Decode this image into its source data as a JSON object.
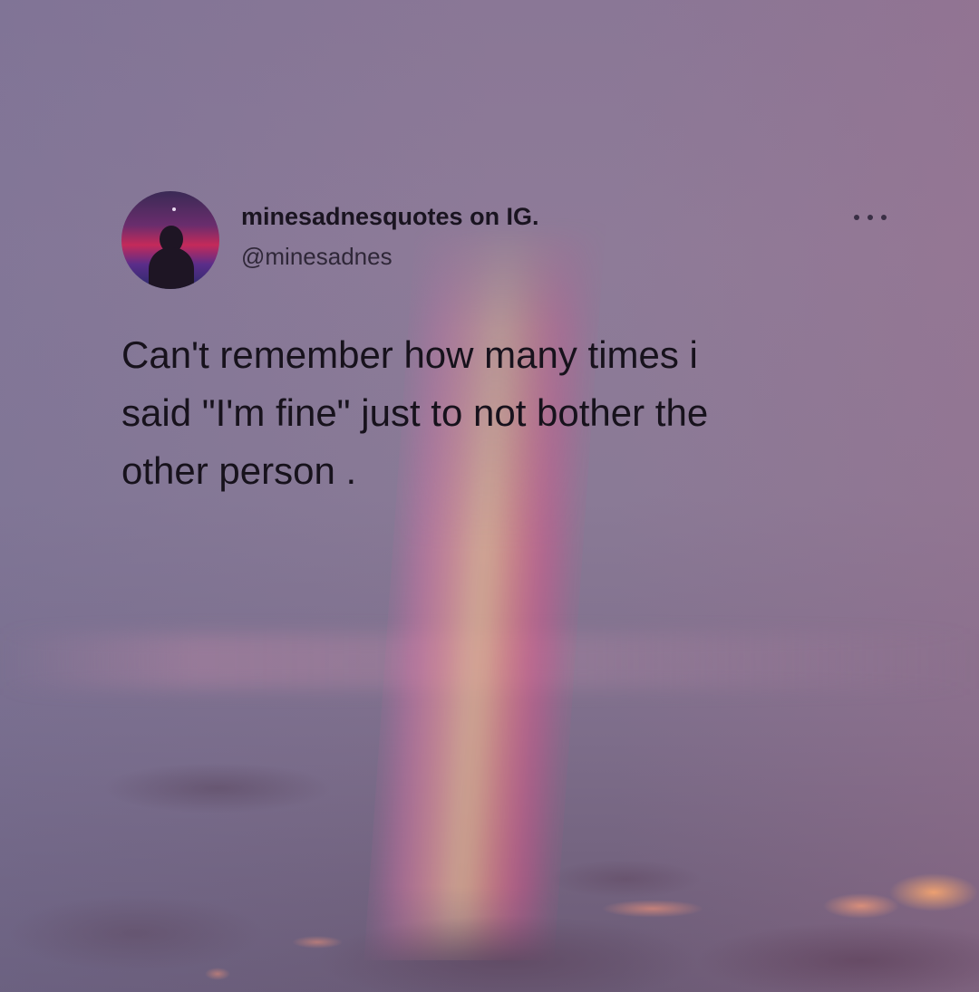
{
  "post": {
    "display_name": "minesadnesquotes on IG.",
    "handle": "@minesadnes",
    "text_lines": [
      "Can't remember how many times i",
      "said \"I'm fine\" just to not bother the",
      "other person ."
    ]
  },
  "icons": {
    "avatar": "avatar-image",
    "menu": "more-options-icon"
  },
  "colors": {
    "text": "#17121c",
    "background_top": "#8a7796",
    "background_bottom": "#6a5a75"
  }
}
